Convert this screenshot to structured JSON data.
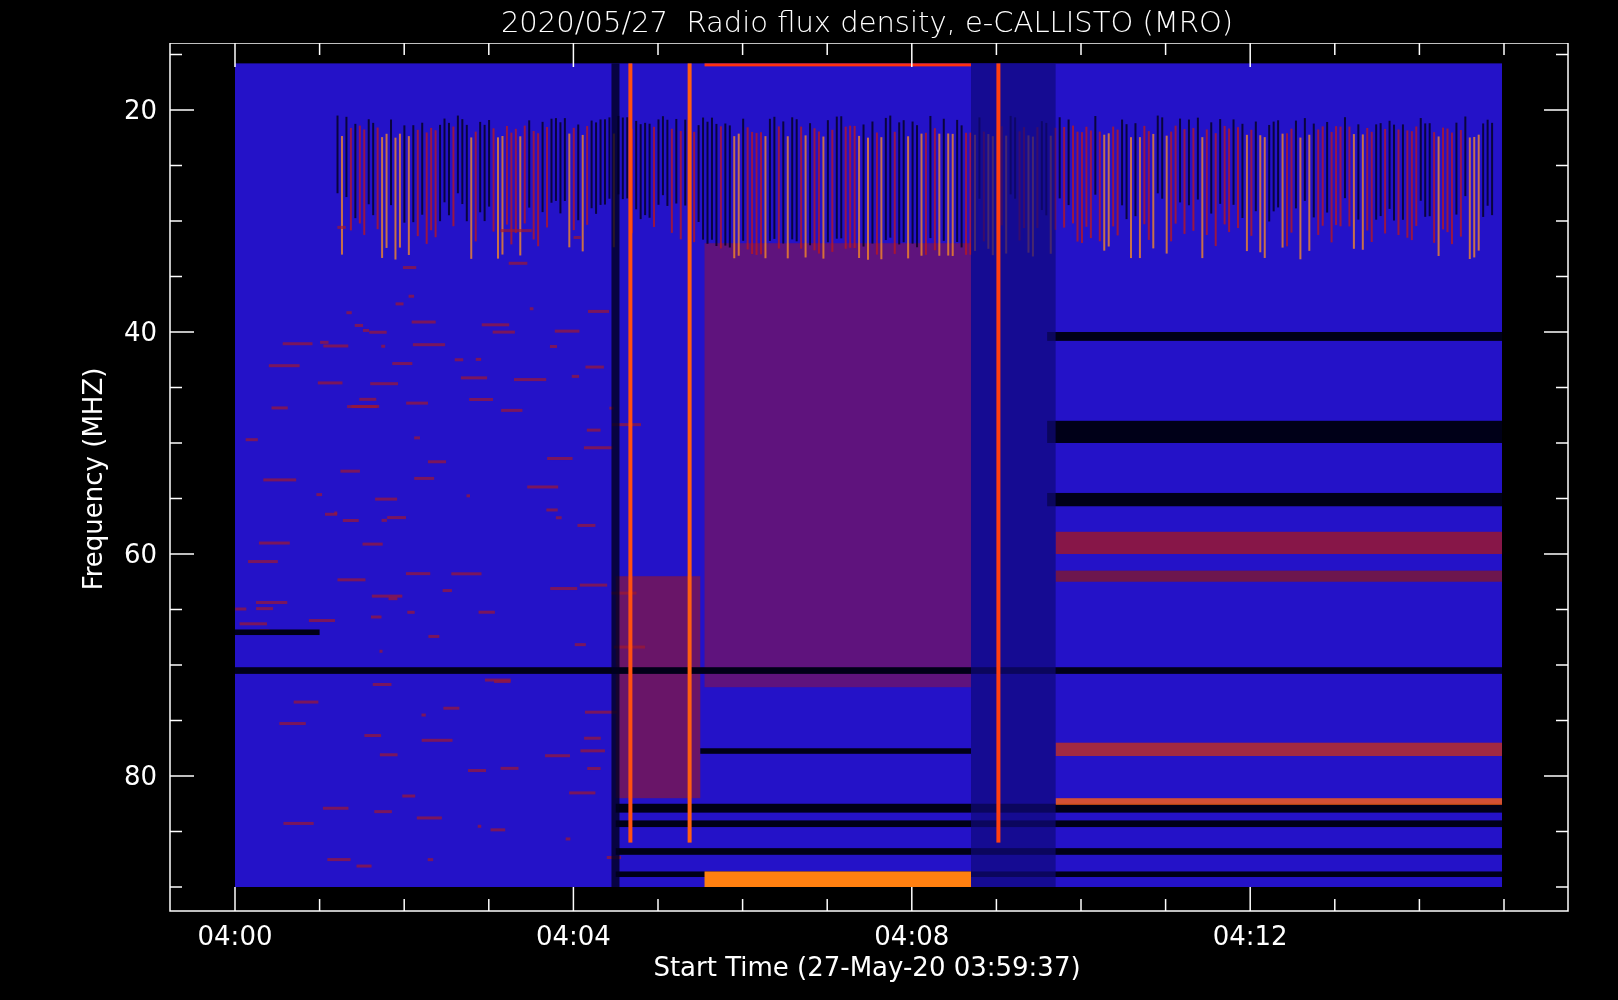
{
  "title": "2020/05/27  Radio flux density, e-CALLISTO (MRO)",
  "chart": {
    "xlabel": "Start Time (27-May-20 03:59:37)",
    "ylabel": "Frequency (MHZ)",
    "xticks": [
      "04:00",
      "04:04",
      "04:08",
      "04:12"
    ],
    "yticks": [
      "20",
      "40",
      "60",
      "80"
    ]
  }
}
